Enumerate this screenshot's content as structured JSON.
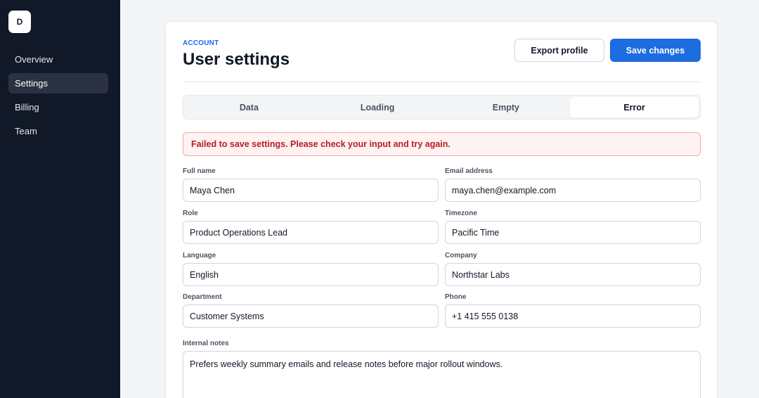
{
  "sidebar": {
    "logo_letter": "D",
    "items": [
      {
        "label": "Overview",
        "active": false
      },
      {
        "label": "Settings",
        "active": true
      },
      {
        "label": "Billing",
        "active": false
      },
      {
        "label": "Team",
        "active": false
      }
    ]
  },
  "header": {
    "eyebrow": "ACCOUNT",
    "title": "User settings",
    "export_label": "Export profile",
    "save_label": "Save changes"
  },
  "tabs": [
    {
      "label": "Data",
      "active": false
    },
    {
      "label": "Loading",
      "active": false
    },
    {
      "label": "Empty",
      "active": false
    },
    {
      "label": "Error",
      "active": true
    }
  ],
  "alert": {
    "message": "Failed to save settings. Please check your input and try again."
  },
  "form": {
    "full_name": {
      "label": "Full name",
      "value": "Maya Chen"
    },
    "email": {
      "label": "Email address",
      "value": "maya.chen@example.com"
    },
    "role": {
      "label": "Role",
      "value": "Product Operations Lead"
    },
    "timezone": {
      "label": "Timezone",
      "value": "Pacific Time"
    },
    "language": {
      "label": "Language",
      "value": "English"
    },
    "company": {
      "label": "Company",
      "value": "Northstar Labs"
    },
    "department": {
      "label": "Department",
      "value": "Customer Systems"
    },
    "phone": {
      "label": "Phone",
      "value": "+1 415 555 0138"
    },
    "notes": {
      "label": "Internal notes",
      "value": "Prefers weekly summary emails and release notes before major rollout windows."
    }
  },
  "colors": {
    "sidebar_bg": "#111827",
    "accent": "#1d6ce0",
    "error_text": "#b91c1c",
    "error_bg": "#fef2f2"
  }
}
